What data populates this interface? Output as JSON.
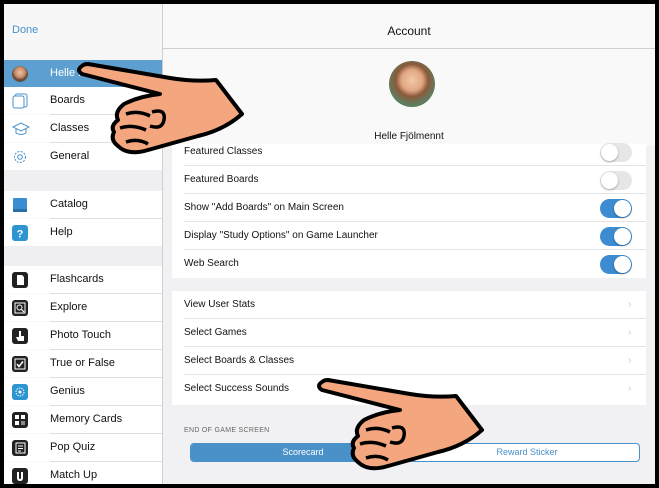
{
  "sidebar": {
    "done_label": "Done",
    "groups": [
      [
        {
          "label": "Helle F",
          "icon": "user-avatar",
          "selected": true
        },
        {
          "label": "Boards",
          "icon": "boards-icon"
        },
        {
          "label": "Classes",
          "icon": "graduation-cap-icon"
        },
        {
          "label": "General",
          "icon": "gear-icon"
        }
      ],
      [
        {
          "label": "Catalog",
          "icon": "book-icon"
        },
        {
          "label": "Help",
          "icon": "help-icon"
        }
      ],
      [
        {
          "label": "Flashcards",
          "icon": "flashcards-icon"
        },
        {
          "label": "Explore",
          "icon": "explore-icon"
        },
        {
          "label": "Photo Touch",
          "icon": "touch-icon"
        },
        {
          "label": "True or False",
          "icon": "checkbox-icon"
        },
        {
          "label": "Genius",
          "icon": "genius-icon"
        },
        {
          "label": "Memory Cards",
          "icon": "memory-cards-icon"
        },
        {
          "label": "Pop Quiz",
          "icon": "pop-quiz-icon"
        },
        {
          "label": "Match Up",
          "icon": "match-up-icon"
        }
      ]
    ]
  },
  "header": {
    "title": "Account"
  },
  "profile": {
    "name": "Helle Fjölmennt"
  },
  "toggles": [
    {
      "label": "Featured Classes",
      "on": false
    },
    {
      "label": "Featured Boards",
      "on": false
    },
    {
      "label": "Show \"Add Boards\" on Main Screen",
      "on": true
    },
    {
      "label": "Display \"Study Options\" on Game Launcher",
      "on": true
    },
    {
      "label": "Web Search",
      "on": true
    }
  ],
  "links": [
    {
      "label": "View User Stats"
    },
    {
      "label": "Select Games"
    },
    {
      "label": "Select Boards & Classes"
    },
    {
      "label": "Select Success Sounds"
    }
  ],
  "end_section": {
    "heading": "END OF GAME SCREEN",
    "options": [
      "Scorecard",
      "Reward Sticker"
    ],
    "selected_index": 0
  },
  "colors": {
    "accent": "#4a90c9",
    "selected_row": "#5d9fd1",
    "hand": "#f4a77e"
  }
}
